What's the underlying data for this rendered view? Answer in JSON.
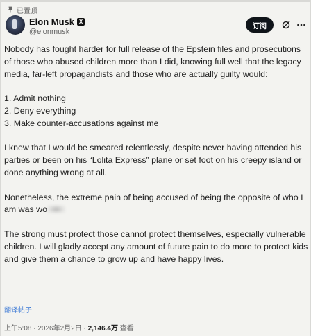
{
  "header": {
    "pinned_label": "已置顶",
    "display_name": "Elon Musk",
    "handle": "@elonmusk",
    "follow_label": "订阅",
    "badge_glyph": "X"
  },
  "tweet": {
    "paragraphs": [
      "Nobody has fought harder for full release of the Epstein files and prosecutions of those who abused children more than I did, knowing full well that the legacy media, far-left propagandists and those who are actually guilty would:",
      "",
      "I knew that I would be smeared relentlessly, despite never having attended his parties or been on his “Lolita Express” plane or set foot on his creepy island or done anything wrong at all.",
      "Nonetheless, the extreme pain of being accused of being the opposite of who I am was wo",
      "The strong must protect those cannot protect themselves, especially vulnerable children. I will gladly accept any amount of future pain to do more to protect kids and give them a chance to grow up and have happy lives."
    ],
    "list_items": [
      "1. Admit nothing",
      "2. Deny everything",
      "3. Make counter-accusations against me"
    ]
  },
  "footer": {
    "translate_label": "翻译帖子",
    "timestamp": "上午5:08 · 2026年2月2日 · ",
    "views": "2,146.4万",
    "views_label": " 查看"
  },
  "icons": {
    "pin": "pin-icon",
    "grok": "grok-icon",
    "more": "more-icon",
    "badge": "x-badge-icon"
  }
}
